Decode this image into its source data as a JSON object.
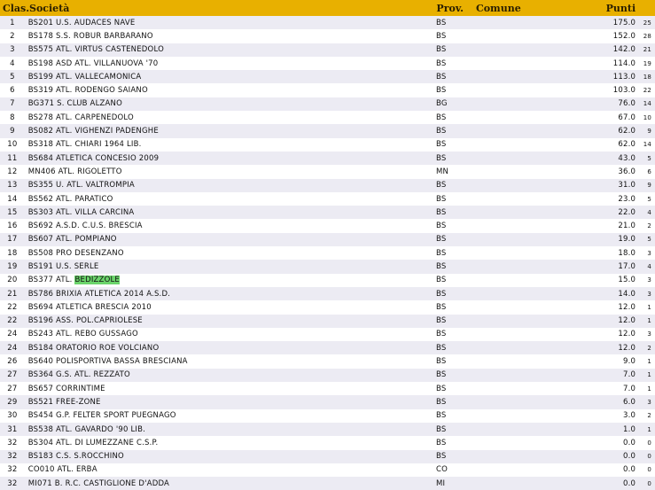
{
  "header": {
    "clas": "Clas.",
    "societa": "Società",
    "prov": "Prov.",
    "comune": "Comune",
    "punti": "Punti"
  },
  "rows": [
    {
      "clas": "1",
      "societa": "BS201 U.S. AUDACES NAVE",
      "prov": "BS",
      "punti": "175.0",
      "n": "25"
    },
    {
      "clas": "2",
      "societa": "BS178 S.S. ROBUR BARBARANO",
      "prov": "BS",
      "punti": "152.0",
      "n": "28"
    },
    {
      "clas": "3",
      "societa": "BS575 ATL. VIRTUS CASTENEDOLO",
      "prov": "BS",
      "punti": "142.0",
      "n": "21"
    },
    {
      "clas": "4",
      "societa": "BS198 ASD ATL. VILLANUOVA '70",
      "prov": "BS",
      "punti": "114.0",
      "n": "19"
    },
    {
      "clas": "5",
      "societa": "BS199 ATL. VALLECAMONICA",
      "prov": "BS",
      "punti": "113.0",
      "n": "18"
    },
    {
      "clas": "6",
      "societa": "BS319 ATL. RODENGO SAIANO",
      "prov": "BS",
      "punti": "103.0",
      "n": "22"
    },
    {
      "clas": "7",
      "societa": "BG371 S. CLUB ALZANO",
      "prov": "BG",
      "punti": "76.0",
      "n": "14"
    },
    {
      "clas": "8",
      "societa": "BS278 ATL. CARPENEDOLO",
      "prov": "BS",
      "punti": "67.0",
      "n": "10"
    },
    {
      "clas": "9",
      "societa": "BS082 ATL. VIGHENZI PADENGHE",
      "prov": "BS",
      "punti": "62.0",
      "n": "9"
    },
    {
      "clas": "10",
      "societa": "BS318 ATL. CHIARI 1964 LIB.",
      "prov": "BS",
      "punti": "62.0",
      "n": "14"
    },
    {
      "clas": "11",
      "societa": "BS684 ATLETICA CONCESIO 2009",
      "prov": "BS",
      "punti": "43.0",
      "n": "5"
    },
    {
      "clas": "12",
      "societa": "MN406 ATL. RIGOLETTO",
      "prov": "MN",
      "punti": "36.0",
      "n": "6"
    },
    {
      "clas": "13",
      "societa": "BS355 U. ATL. VALTROMPIA",
      "prov": "BS",
      "punti": "31.0",
      "n": "9"
    },
    {
      "clas": "14",
      "societa": "BS562 ATL. PARATICO",
      "prov": "BS",
      "punti": "23.0",
      "n": "5"
    },
    {
      "clas": "15",
      "societa": "BS303 ATL. VILLA CARCINA",
      "prov": "BS",
      "punti": "22.0",
      "n": "4"
    },
    {
      "clas": "16",
      "societa": "BS692 A.S.D. C.U.S. BRESCIA",
      "prov": "BS",
      "punti": "21.0",
      "n": "2"
    },
    {
      "clas": "17",
      "societa": "BS607 ATL. POMPIANO",
      "prov": "BS",
      "punti": "19.0",
      "n": "5"
    },
    {
      "clas": "18",
      "societa": "BS508 PRO DESENZANO",
      "prov": "BS",
      "punti": "18.0",
      "n": "3"
    },
    {
      "clas": "19",
      "societa": "BS191 U.S. SERLE",
      "prov": "BS",
      "punti": "17.0",
      "n": "4"
    },
    {
      "clas": "20",
      "societa_pre": "BS377 ATL. ",
      "societa_hl": "BEDIZZOLE",
      "prov": "BS",
      "punti": "15.0",
      "n": "3"
    },
    {
      "clas": "21",
      "societa": "BS786 BRIXIA ATLETICA 2014 A.S.D.",
      "prov": "BS",
      "punti": "14.0",
      "n": "3"
    },
    {
      "clas": "22",
      "societa": "BS694 ATLETICA BRESCIA 2010",
      "prov": "BS",
      "punti": "12.0",
      "n": "1"
    },
    {
      "clas": "22",
      "societa": "BS196 ASS. POL.CAPRIOLESE",
      "prov": "BS",
      "punti": "12.0",
      "n": "1"
    },
    {
      "clas": "24",
      "societa": "BS243 ATL. REBO GUSSAGO",
      "prov": "BS",
      "punti": "12.0",
      "n": "3"
    },
    {
      "clas": "24",
      "societa": "BS184 ORATORIO ROE VOLCIANO",
      "prov": "BS",
      "punti": "12.0",
      "n": "2"
    },
    {
      "clas": "26",
      "societa": "BS640 POLISPORTIVA BASSA BRESCIANA",
      "prov": "BS",
      "punti": "9.0",
      "n": "1"
    },
    {
      "clas": "27",
      "societa": "BS364 G.S. ATL. REZZATO",
      "prov": "BS",
      "punti": "7.0",
      "n": "1"
    },
    {
      "clas": "27",
      "societa": "BS657 CORRINTIME",
      "prov": "BS",
      "punti": "7.0",
      "n": "1"
    },
    {
      "clas": "29",
      "societa": "BS521 FREE-ZONE",
      "prov": "BS",
      "punti": "6.0",
      "n": "3"
    },
    {
      "clas": "30",
      "societa": "BS454 G.P. FELTER SPORT PUEGNAGO",
      "prov": "BS",
      "punti": "3.0",
      "n": "2"
    },
    {
      "clas": "31",
      "societa": "BS538 ATL. GAVARDO '90 LIB.",
      "prov": "BS",
      "punti": "1.0",
      "n": "1"
    },
    {
      "clas": "32",
      "societa": "BS304 ATL. DI LUMEZZANE C.S.P.",
      "prov": "BS",
      "punti": "0.0",
      "n": "0"
    },
    {
      "clas": "32",
      "societa": "BS183 C.S. S.ROCCHINO",
      "prov": "BS",
      "punti": "0.0",
      "n": "0"
    },
    {
      "clas": "32",
      "societa": "CO010 ATL. ERBA",
      "prov": "CO",
      "punti": "0.0",
      "n": "0"
    },
    {
      "clas": "32",
      "societa": "MI071 B. R.C. CASTIGLIONE D'ADDA",
      "prov": "MI",
      "punti": "0.0",
      "n": "0"
    }
  ]
}
